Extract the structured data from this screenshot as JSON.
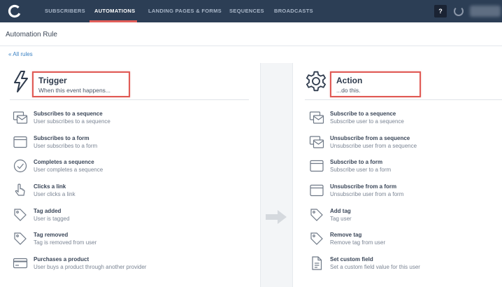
{
  "nav": {
    "items": [
      {
        "label": "SUBSCRIBERS",
        "active": false
      },
      {
        "label": "AUTOMATIONS",
        "active": true
      },
      {
        "label": "LANDING PAGES & FORMS",
        "active": false
      },
      {
        "label": "SEQUENCES",
        "active": false
      },
      {
        "label": "BROADCASTS",
        "active": false
      }
    ],
    "help_label": "?",
    "accent_color": "#e15e5a"
  },
  "page": {
    "title": "Automation Rule",
    "back_link": "« All rules"
  },
  "trigger": {
    "title": "Trigger",
    "subtitle": "When this event happens...",
    "icon": "lightning-icon",
    "items": [
      {
        "title": "Subscribes to a sequence",
        "desc": "User subscribes to a sequence",
        "icon": "sequence-icon"
      },
      {
        "title": "Subscribes to a form",
        "desc": "User subscribes to a form",
        "icon": "form-icon"
      },
      {
        "title": "Completes a sequence",
        "desc": "User completes a sequence",
        "icon": "check-circle-icon"
      },
      {
        "title": "Clicks a link",
        "desc": "User clicks a link",
        "icon": "pointer-icon"
      },
      {
        "title": "Tag added",
        "desc": "User is tagged",
        "icon": "tag-icon"
      },
      {
        "title": "Tag removed",
        "desc": "Tag is removed from user",
        "icon": "tag-icon"
      },
      {
        "title": "Purchases a product",
        "desc": "User buys a product through another provider",
        "icon": "credit-card-icon"
      }
    ]
  },
  "action": {
    "title": "Action",
    "subtitle": "...do this.",
    "icon": "gear-icon",
    "items": [
      {
        "title": "Subscribe to a sequence",
        "desc": "Subscribe user to a sequence",
        "icon": "sequence-icon"
      },
      {
        "title": "Unsubscribe from a sequence",
        "desc": "Unsubscribe user from a sequence",
        "icon": "sequence-icon"
      },
      {
        "title": "Subscribe to a form",
        "desc": "Subscribe user to a form",
        "icon": "form-icon"
      },
      {
        "title": "Unsubscribe from a form",
        "desc": "Unsubscribe user from a form",
        "icon": "form-icon"
      },
      {
        "title": "Add tag",
        "desc": "Tag user",
        "icon": "tag-icon"
      },
      {
        "title": "Remove tag",
        "desc": "Remove tag from user",
        "icon": "tag-icon"
      },
      {
        "title": "Set custom field",
        "desc": "Set a custom field value for this user",
        "icon": "document-icon"
      }
    ]
  }
}
